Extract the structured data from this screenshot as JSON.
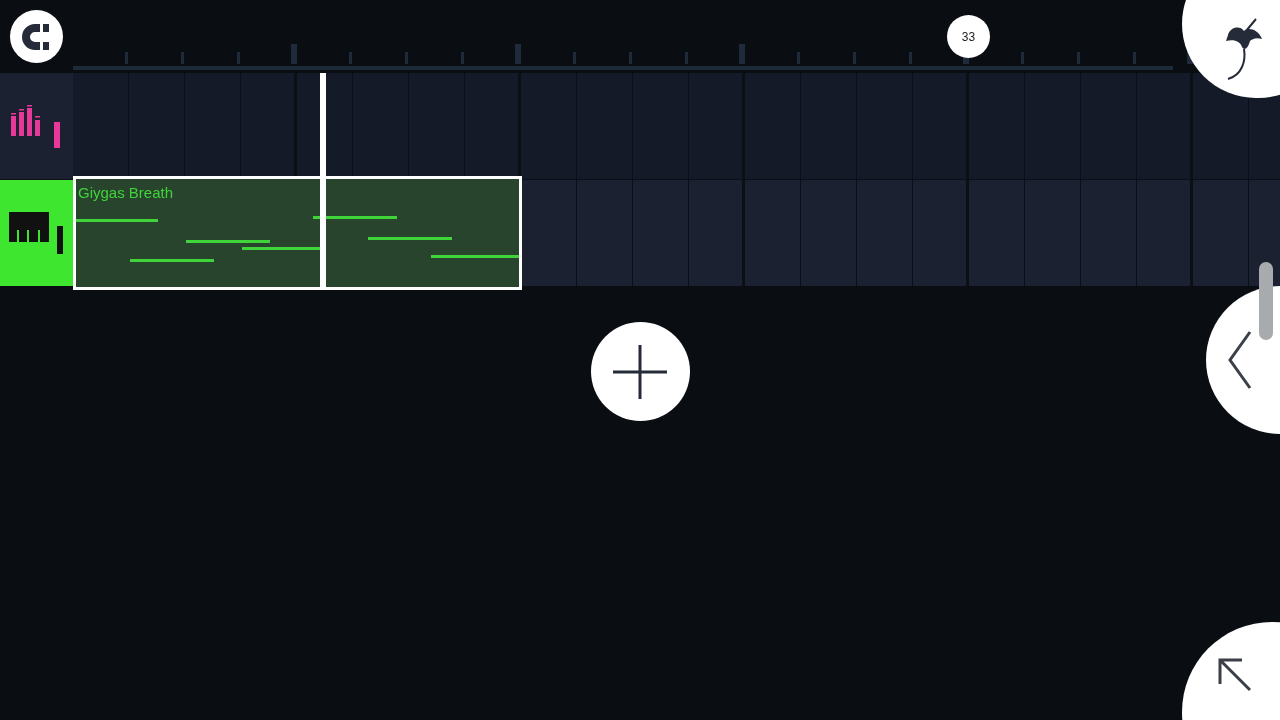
{
  "ruler": {
    "marker": "33"
  },
  "tracks": [
    {
      "kind": "audio",
      "selected": false
    },
    {
      "kind": "instrument",
      "selected": true,
      "clip": {
        "name": "Giygas Breath",
        "selected": true
      }
    }
  ]
}
